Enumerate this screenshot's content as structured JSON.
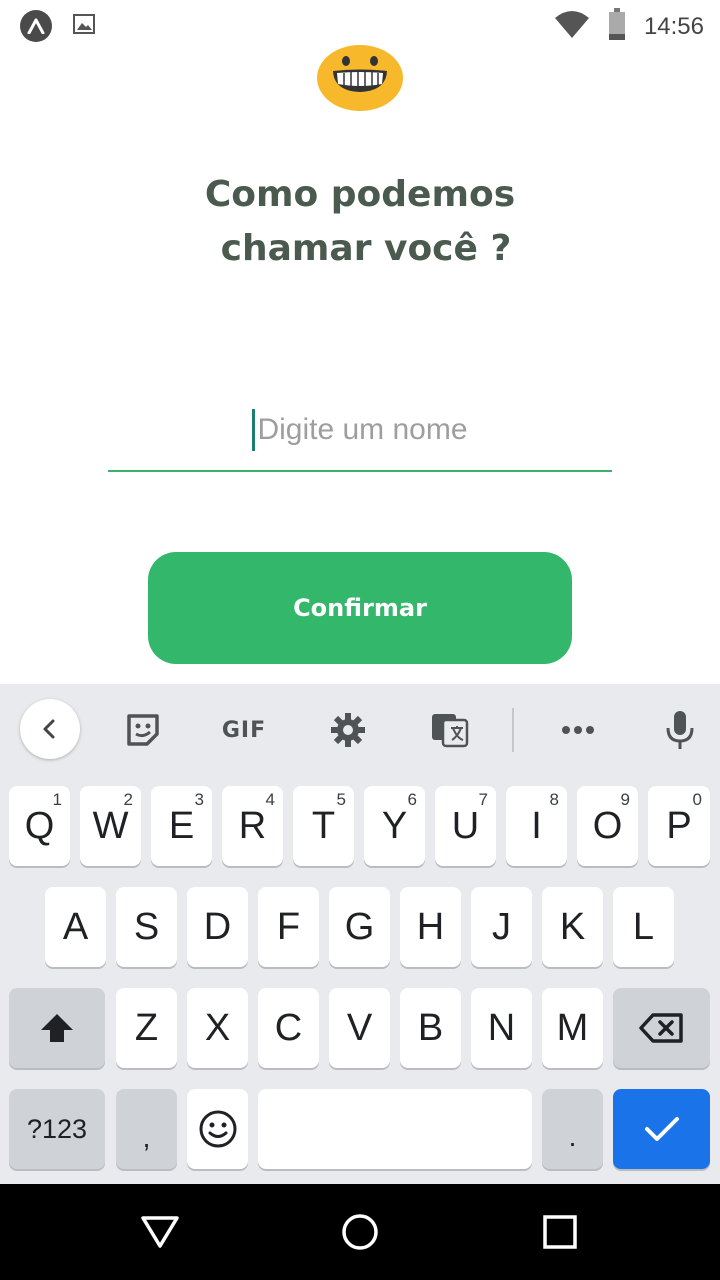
{
  "status_bar": {
    "time": "14:56",
    "left_icons": [
      "app-a-icon",
      "image-icon"
    ],
    "right_icons": [
      "wifi-icon",
      "battery-icon"
    ]
  },
  "main": {
    "emoji_icon": "grinning-face-icon",
    "title_line1": "Como podemos",
    "title_line2": "chamar você ?",
    "name_input": {
      "placeholder": "Digite um nome",
      "value": ""
    },
    "confirm_label": "Confirmar",
    "accent_color": "#33b76a",
    "title_color": "#4a5a4f"
  },
  "keyboard": {
    "toolbar": {
      "back_icon": "chevron-left-icon",
      "sticker_icon": "sticker-icon",
      "gif_label": "GIF",
      "settings_icon": "gear-icon",
      "translate_icon": "translate-icon",
      "more_icon": "more-horizontal-icon",
      "mic_icon": "microphone-icon"
    },
    "row1": [
      {
        "k": "Q",
        "h": "1"
      },
      {
        "k": "W",
        "h": "2"
      },
      {
        "k": "E",
        "h": "3"
      },
      {
        "k": "R",
        "h": "4"
      },
      {
        "k": "T",
        "h": "5"
      },
      {
        "k": "Y",
        "h": "6"
      },
      {
        "k": "U",
        "h": "7"
      },
      {
        "k": "I",
        "h": "8"
      },
      {
        "k": "O",
        "h": "9"
      },
      {
        "k": "P",
        "h": "0"
      }
    ],
    "row2": [
      "A",
      "S",
      "D",
      "F",
      "G",
      "H",
      "J",
      "K",
      "L"
    ],
    "row3": [
      "Z",
      "X",
      "C",
      "V",
      "B",
      "N",
      "M"
    ],
    "symbols_label": "?123",
    "comma_label": ",",
    "period_label": ".",
    "shift_icon": "shift-icon",
    "backspace_icon": "backspace-icon",
    "emoji_icon": "emoji-icon",
    "enter_icon": "checkmark-icon",
    "action_color": "#1a73e8"
  },
  "nav_bar": {
    "back_icon": "triangle-back-icon",
    "home_icon": "circle-home-icon",
    "recents_icon": "square-recents-icon"
  }
}
